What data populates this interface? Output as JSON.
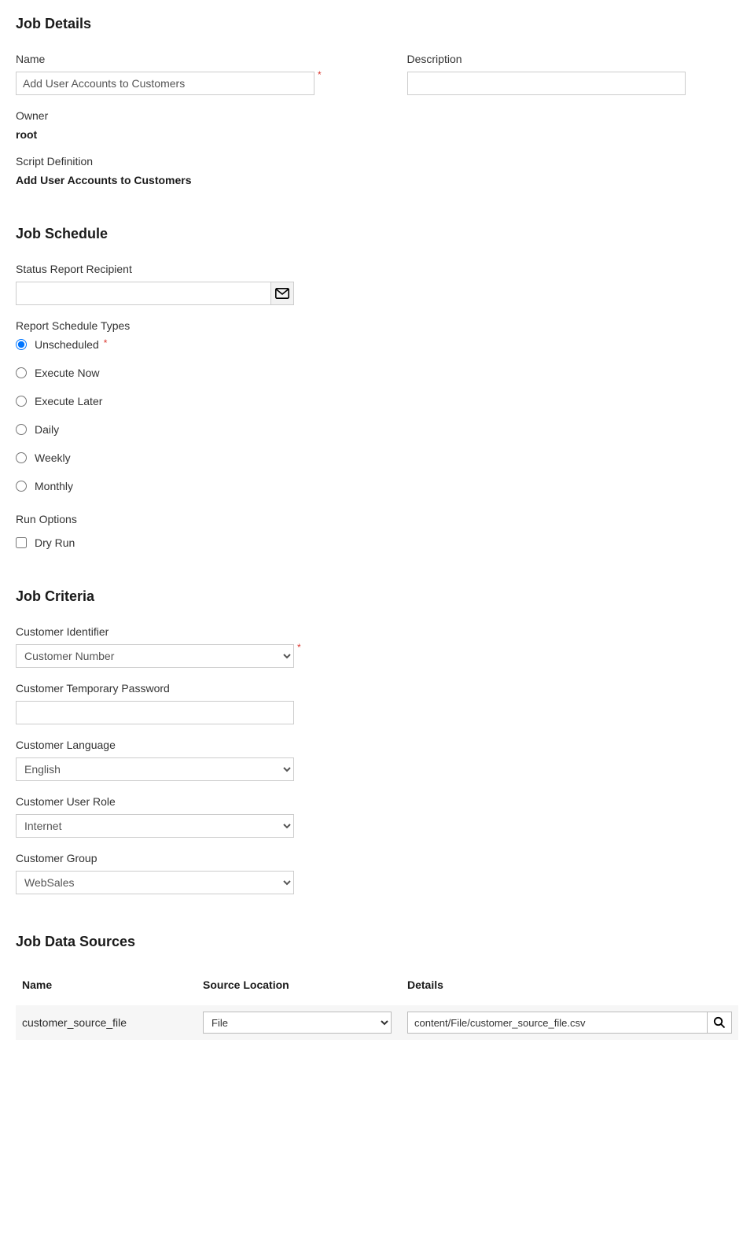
{
  "details": {
    "heading": "Job Details",
    "name_label": "Name",
    "name_value": "Add User Accounts to Customers",
    "description_label": "Description",
    "description_value": "",
    "owner_label": "Owner",
    "owner_value": "root",
    "script_def_label": "Script Definition",
    "script_def_value": "Add User Accounts to Customers"
  },
  "schedule": {
    "heading": "Job Schedule",
    "recipient_label": "Status Report Recipient",
    "recipient_value": "",
    "types_label": "Report Schedule Types",
    "types": [
      {
        "label": "Unscheduled",
        "checked": true
      },
      {
        "label": "Execute Now",
        "checked": false
      },
      {
        "label": "Execute Later",
        "checked": false
      },
      {
        "label": "Daily",
        "checked": false
      },
      {
        "label": "Weekly",
        "checked": false
      },
      {
        "label": "Monthly",
        "checked": false
      }
    ],
    "run_options_label": "Run Options",
    "dry_run_label": "Dry Run",
    "dry_run_checked": false
  },
  "criteria": {
    "heading": "Job Criteria",
    "identifier_label": "Customer Identifier",
    "identifier_value": "Customer Number",
    "temp_pass_label": "Customer Temporary Password",
    "temp_pass_value": "",
    "language_label": "Customer Language",
    "language_value": "English",
    "role_label": "Customer User Role",
    "role_value": "Internet",
    "group_label": "Customer Group",
    "group_value": "WebSales"
  },
  "data_sources": {
    "heading": "Job Data Sources",
    "columns": {
      "name": "Name",
      "location": "Source Location",
      "details": "Details"
    },
    "rows": [
      {
        "name": "customer_source_file",
        "location": "File",
        "details": "content/File/customer_source_file.csv"
      }
    ]
  }
}
